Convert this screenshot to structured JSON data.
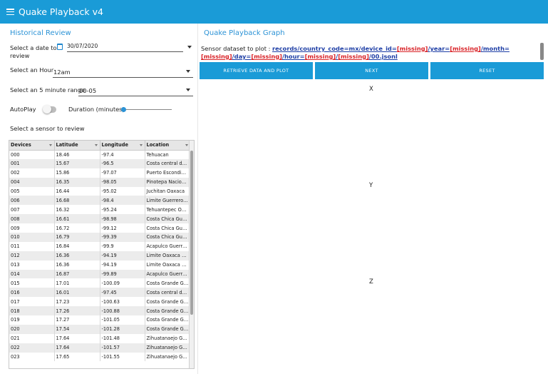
{
  "appbar": {
    "title": "Quake Playback v4"
  },
  "left": {
    "title": "Historical Review",
    "date_label": "Select a date to review",
    "date_value": "30/07/2020",
    "hour_label": "Select an Hour",
    "hour_value": "12am",
    "range_label": "Select an 5 minute range",
    "range_value": "00-05",
    "autoplay_label": "AutoPlay",
    "autoplay_on": false,
    "duration_label": "Duration (minutes)",
    "duration_fraction": 0.02,
    "sensor_label": "Select a sensor to review",
    "table": {
      "headers": [
        "Devices",
        "Latitude",
        "Longitude",
        "Location"
      ],
      "rows": [
        [
          "000",
          "18.46",
          "-97.4",
          "Tehuacan"
        ],
        [
          "001",
          "15.67",
          "-96.5",
          "Costa central de Oaxaca"
        ],
        [
          "002",
          "15.86",
          "-97.07",
          "Puerto Escondido Oaxaca"
        ],
        [
          "004",
          "16.35",
          "-98.05",
          "Pinotepa Nacional Oaxaca"
        ],
        [
          "005",
          "16.44",
          "-95.02",
          "Juchitan Oaxaca"
        ],
        [
          "006",
          "16.68",
          "-98.4",
          "Limite Guerrero Oaxaca"
        ],
        [
          "007",
          "16.32",
          "-95.24",
          "Tehuantepec Oaxaca"
        ],
        [
          "008",
          "16.61",
          "-98.98",
          "Costa Chica Guerrero"
        ],
        [
          "009",
          "16.72",
          "-99.12",
          "Costa Chica Guerrero"
        ],
        [
          "010",
          "16.79",
          "-99.39",
          "Costa Chica Guerrero"
        ],
        [
          "011",
          "16.84",
          "-99.9",
          "Acapulco Guerrero"
        ],
        [
          "012",
          "16.36",
          "-94.19",
          "Limite Oaxaca Chiapas"
        ],
        [
          "013",
          "16.36",
          "-94.19",
          "Limite Oaxaca Chiapas"
        ],
        [
          "014",
          "16.87",
          "-99.89",
          "Acapulco Guerrero"
        ],
        [
          "015",
          "17.01",
          "-100.09",
          "Costa Grande Guerrero"
        ],
        [
          "016",
          "16.01",
          "-97.45",
          "Costa central de Oaxaca"
        ],
        [
          "017",
          "17.23",
          "-100.63",
          "Costa Grande Guerrero"
        ],
        [
          "018",
          "17.26",
          "-100.88",
          "Costa Grande Guerrero"
        ],
        [
          "019",
          "17.27",
          "-101.05",
          "Costa Grande Guerrero"
        ],
        [
          "020",
          "17.54",
          "-101.28",
          "Costa Grande Guerrero"
        ],
        [
          "021",
          "17.64",
          "-101.48",
          "Zihuatanaejo Guerrero"
        ],
        [
          "022",
          "17.64",
          "-101.57",
          "Zihuatanaejo Guerrero"
        ],
        [
          "023",
          "17.65",
          "-101.55",
          "Zihuatanaejo Guerrero"
        ]
      ]
    }
  },
  "right": {
    "title": "Quake Playback Graph",
    "sensor_prefix": "Sensor dataset to plot : ",
    "path_parts": [
      {
        "text": "records/country_code=mx/device_id=",
        "missing": false
      },
      {
        "text": "[missing]",
        "missing": true
      },
      {
        "text": "/year=",
        "missing": false
      },
      {
        "text": "[missing]",
        "missing": true
      },
      {
        "text": "/month=",
        "missing": false
      },
      {
        "text": "[missing]",
        "missing": true
      },
      {
        "text": "/day=",
        "missing": false
      },
      {
        "text": "[missing]",
        "missing": true
      },
      {
        "text": "/hour=",
        "missing": false
      },
      {
        "text": "[missing]",
        "missing": true
      },
      {
        "text": "/",
        "missing": false
      },
      {
        "text": "[missing]",
        "missing": true
      },
      {
        "text": "/00.jsonl",
        "missing": false
      }
    ],
    "buttons": {
      "retrieve": "RETRIEVE DATA AND PLOT",
      "next": "NEXT",
      "reset": "RESET"
    },
    "axes": {
      "x": "X",
      "y": "Y",
      "z": "Z"
    }
  },
  "colors": {
    "accent": "#1a9bd7",
    "title_blue": "#2c93d6",
    "link_blue": "#1f3fa6",
    "missing_red": "#d9252a"
  }
}
